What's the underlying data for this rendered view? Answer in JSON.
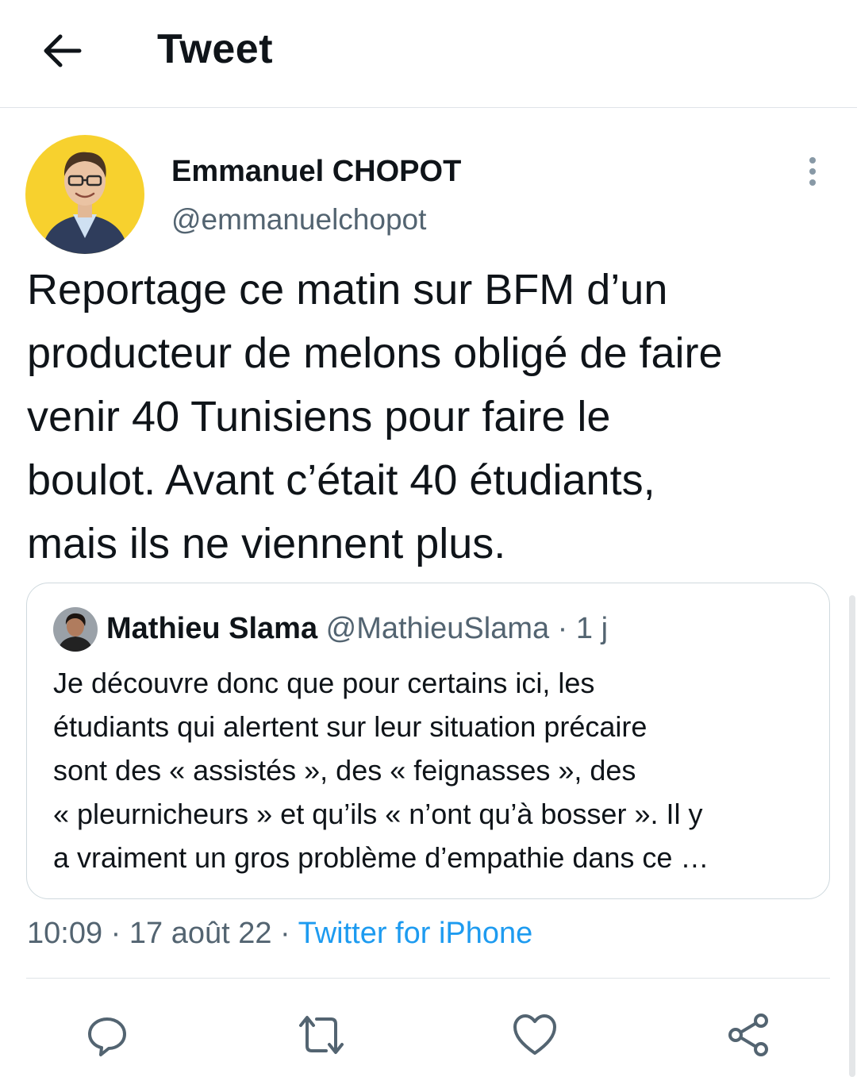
{
  "header": {
    "title": "Tweet",
    "back_icon": "arrow-left-icon"
  },
  "tweet": {
    "author_name": "Emmanuel CHOPOT",
    "author_handle": "@emmanuelchopot",
    "text": "Reportage ce matin sur BFM d’un\nproducteur de melons obligé de faire\nvenir 40 Tunisiens pour faire le\nboulot. Avant c’était 40 étudiants,\nmais ils ne viennent plus.",
    "time": "10:09",
    "separator": " · ",
    "date": "17 août 22",
    "source": "Twitter for iPhone"
  },
  "quote": {
    "author_name": "Mathieu Slama",
    "author_handle": "@MathieuSlama",
    "separator": " · ",
    "age": "1 j",
    "text": "Je découvre donc que pour certains ici, les\nétudiants qui alertent sur leur situation précaire\nsont des « assistés », des « feignasses », des\n« pleurnicheurs » et qu’ils « n’ont qu’à bosser ». Il y\na vraiment un gros problème d’empathie dans ce …"
  },
  "actions": {
    "icons": [
      "reply-icon",
      "retweet-icon",
      "like-icon",
      "share-icon"
    ]
  },
  "colors": {
    "text": "#0f1419",
    "secondary": "#536471",
    "link": "#1d9bf0",
    "avatar_bg": "#f7d12e",
    "border": "#cfd9de"
  }
}
